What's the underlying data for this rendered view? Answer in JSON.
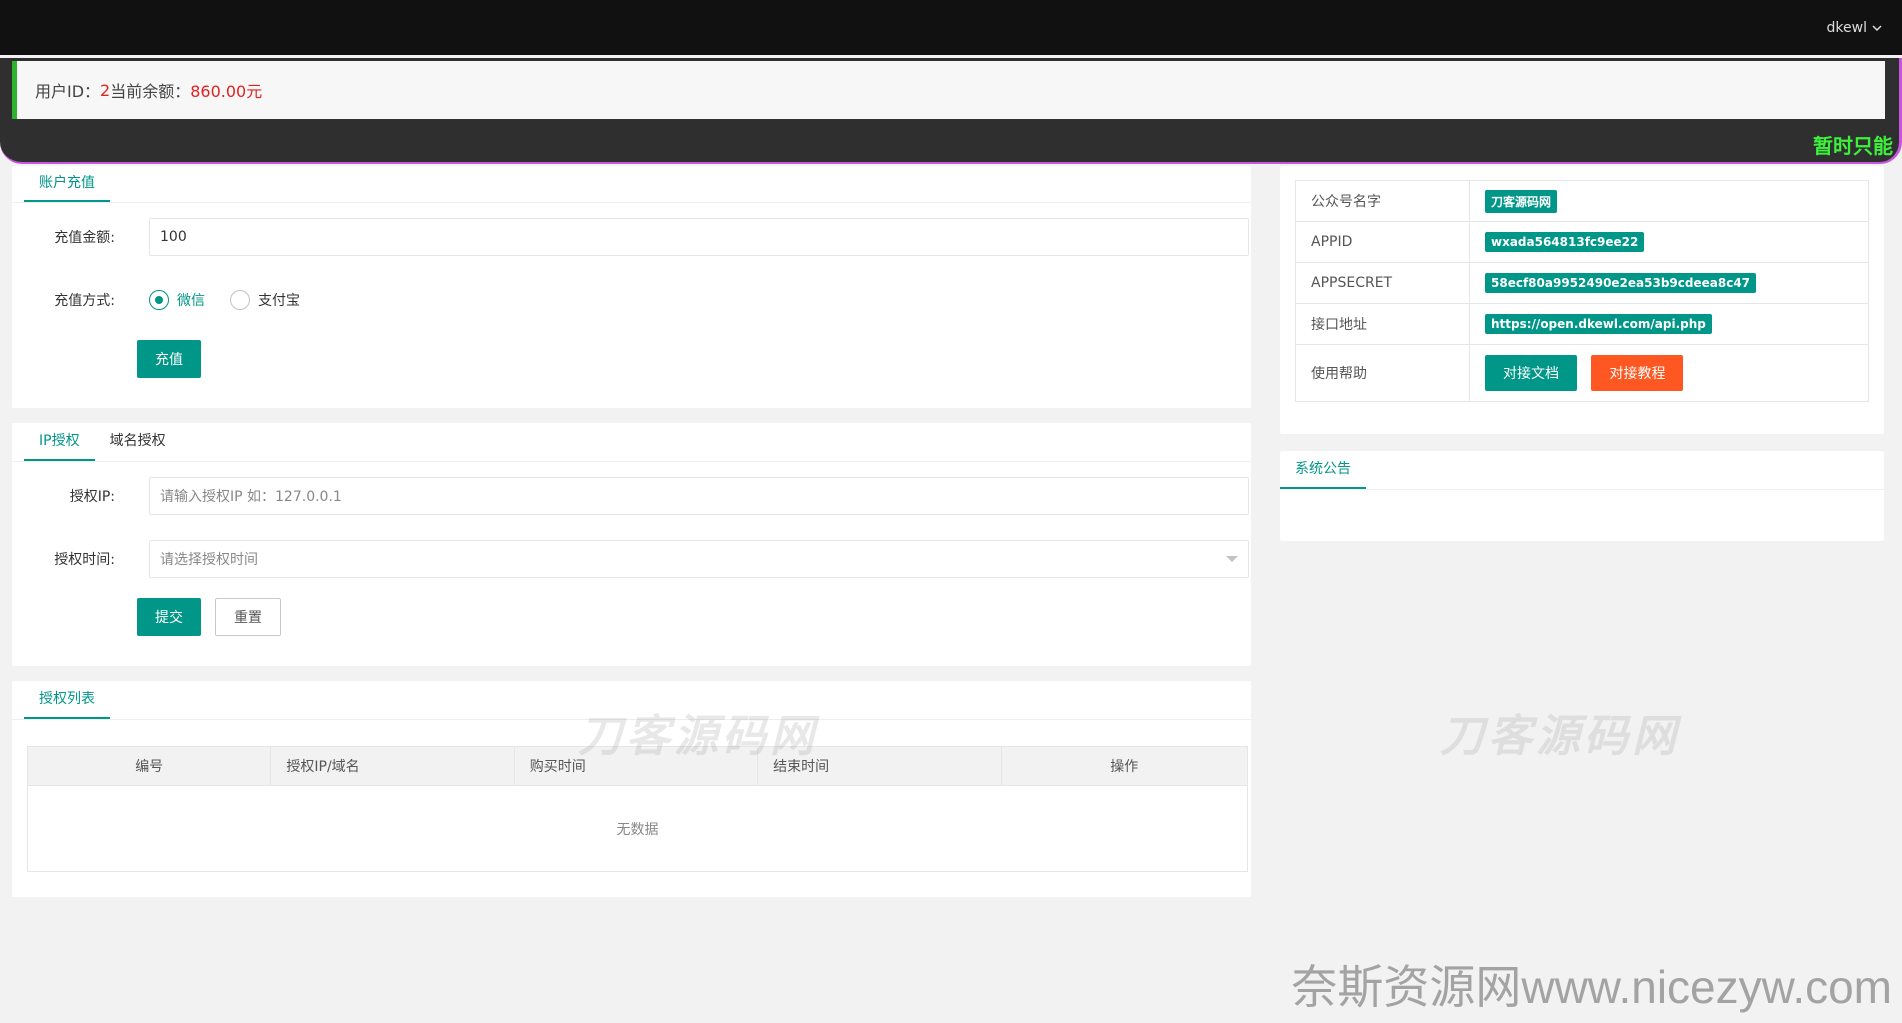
{
  "header": {
    "username": "dkewl"
  },
  "notice": {
    "uid_label": "用户ID：",
    "uid_value": "2",
    "balance_label": " 当前余额：",
    "balance_value": "860.00元",
    "marquee": "暂时只能"
  },
  "recharge": {
    "tab": "账户充值",
    "amount_label": "充值金额:",
    "amount_value": "100",
    "method_label": "充值方式:",
    "methods": [
      "微信",
      "支付宝"
    ],
    "selected_method": "微信",
    "submit": "充值"
  },
  "auth": {
    "tabs": [
      "IP授权",
      "域名授权"
    ],
    "ip_label": "授权IP:",
    "ip_placeholder": "请输入授权IP 如：127.0.0.1",
    "time_label": "授权时间:",
    "time_placeholder": "请选择授权时间",
    "submit": "提交",
    "reset": "重置"
  },
  "list": {
    "tab": "授权列表",
    "columns": [
      "编号",
      "授权IP/域名",
      "购买时间",
      "结束时间",
      "操作"
    ],
    "empty": "无数据"
  },
  "info": {
    "rows": [
      {
        "key": "公众号名字",
        "value": "刀客源码网"
      },
      {
        "key": "APPID",
        "value": "wxada564813fc9ee22"
      },
      {
        "key": "APPSECRET",
        "value": "58ecf80a9952490e2ea53b9cdeea8c47"
      },
      {
        "key": "接口地址",
        "value": "https://open.dkewl.com/api.php"
      }
    ],
    "help_label": "使用帮助",
    "doc_button": "对接文档",
    "tutorial_button": "对接教程"
  },
  "announcement": {
    "tab": "系统公告"
  },
  "watermarks": {
    "left": "刀客源码网",
    "right": "刀客源码网",
    "bottom": "奈斯资源网www.nicezyw.com"
  },
  "colors": {
    "accent": "#009688",
    "orange": "#ff5722",
    "topbar": "#111111",
    "highlight_red": "#e02222",
    "marquee_green": "#3cf03c"
  }
}
